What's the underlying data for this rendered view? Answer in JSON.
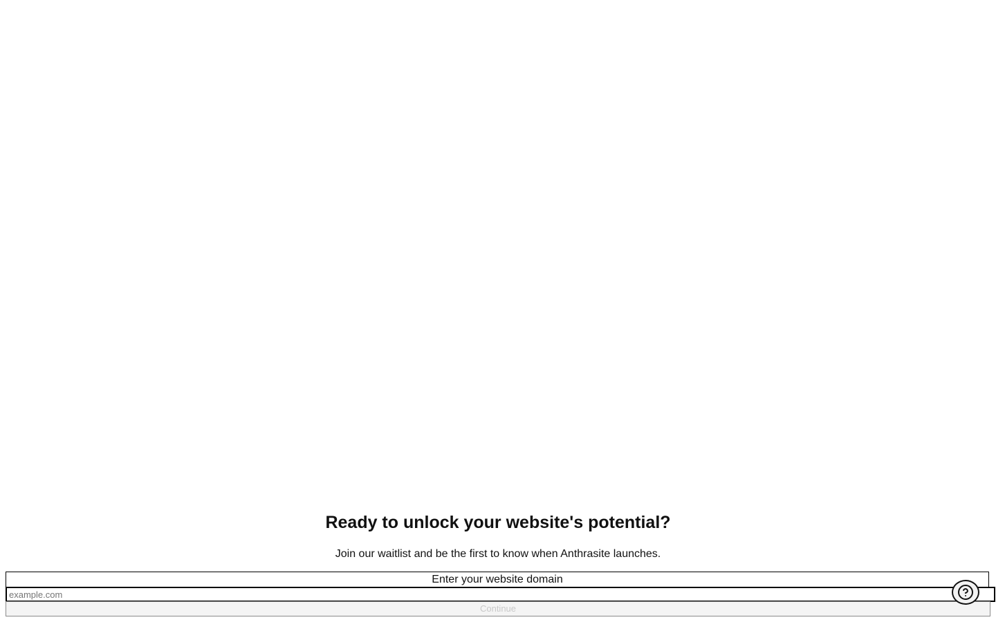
{
  "cta": {
    "headline": "Ready to unlock your website's potential?",
    "subtext": "Join our waitlist and be the first to know when Anthrasite launches."
  },
  "form": {
    "label": "Enter your website domain",
    "input_value": "",
    "input_placeholder": "example.com",
    "submit_label": "Continue",
    "submit_disabled": true
  },
  "help": {
    "icon": "question-circle-icon"
  },
  "colors": {
    "text": "#111111",
    "border": "#000000",
    "disabled_text": "#c8c8c8",
    "button_bg": "#f4f4f4",
    "placeholder": "#757575"
  }
}
